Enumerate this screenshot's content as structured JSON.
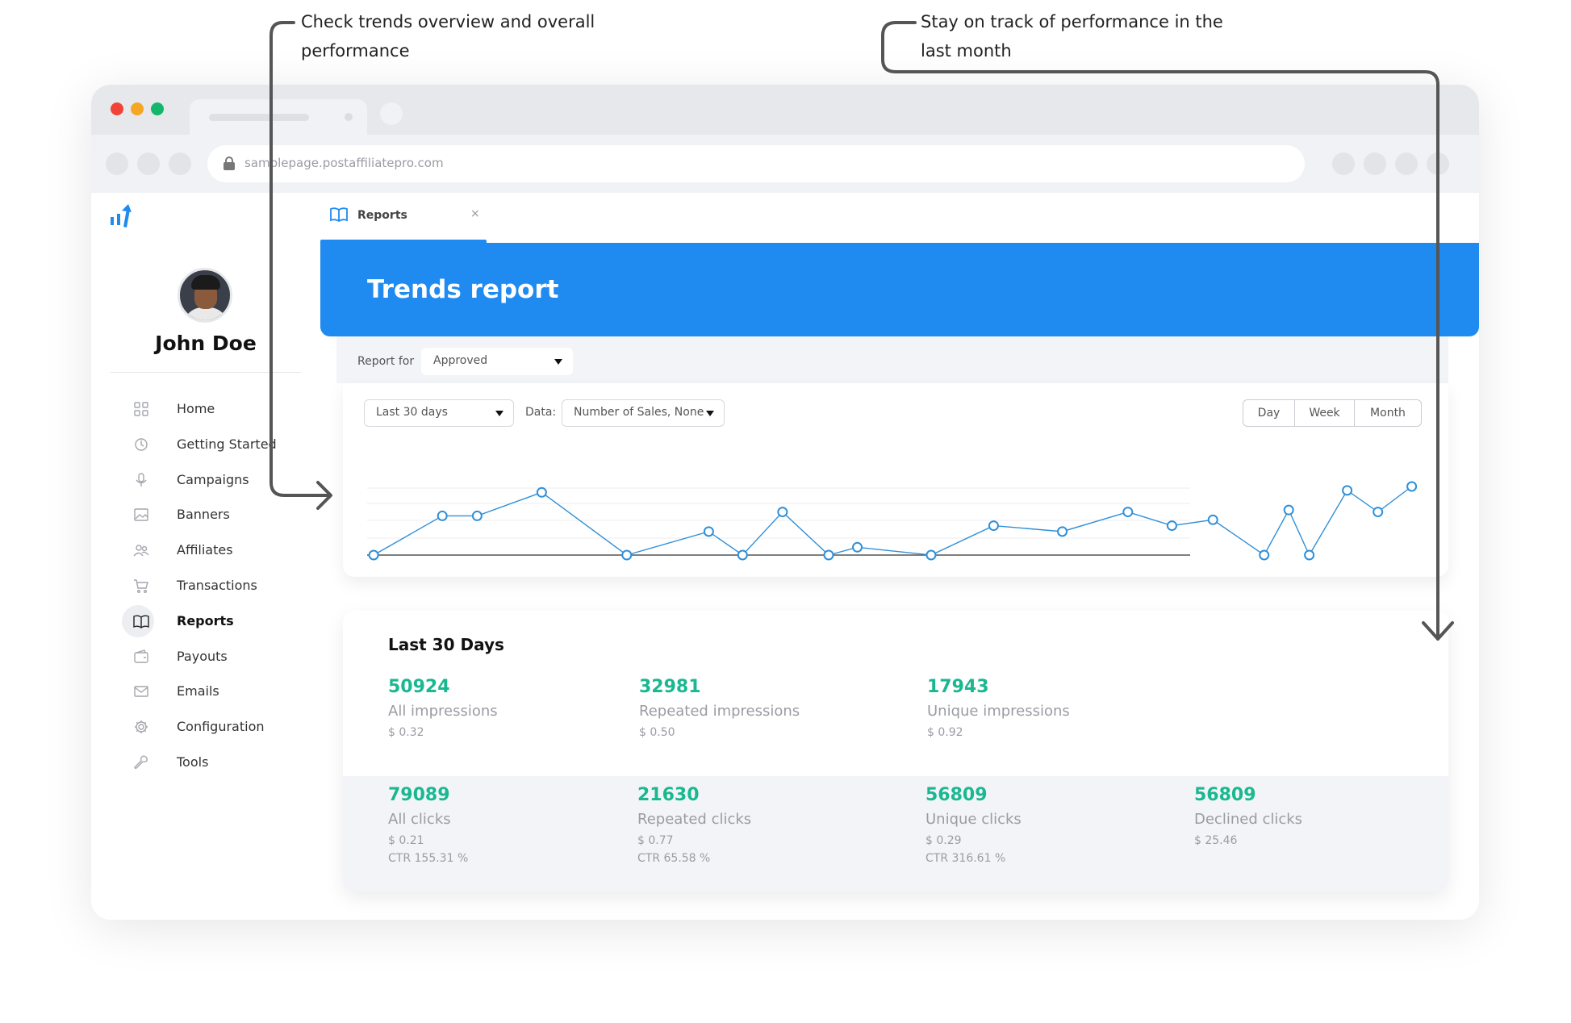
{
  "annotations": {
    "left": "Check trends overview and overall performance",
    "right": "Stay on track of performance in the last month"
  },
  "browser": {
    "url": "samplepage.postaffiliatepro.com"
  },
  "app": {
    "tab_label": "Reports",
    "tab_close": "×",
    "user_name": "John Doe",
    "nav": [
      {
        "label": "Home",
        "icon": "grid-icon"
      },
      {
        "label": "Getting Started",
        "icon": "clock-icon"
      },
      {
        "label": "Campaigns",
        "icon": "microphone-icon"
      },
      {
        "label": "Banners",
        "icon": "image-icon"
      },
      {
        "label": "Affiliates",
        "icon": "users-icon"
      },
      {
        "label": "Transactions",
        "icon": "cart-icon"
      },
      {
        "label": "Reports",
        "icon": "book-icon"
      },
      {
        "label": "Payouts",
        "icon": "wallet-icon"
      },
      {
        "label": "Emails",
        "icon": "mail-icon"
      },
      {
        "label": "Configuration",
        "icon": "gear-icon"
      },
      {
        "label": "Tools",
        "icon": "wrench-icon"
      }
    ],
    "active_nav": "Reports"
  },
  "report": {
    "title": "Trends report",
    "report_for_label": "Report for",
    "report_for_value": "Approved",
    "range_value": "Last 30 days",
    "data_label": "Data:",
    "metric_value": "Number of Sales, None",
    "period_buttons": [
      "Day",
      "Week",
      "Month"
    ]
  },
  "chart_data": {
    "type": "line",
    "x": [
      1,
      2,
      3,
      4,
      5,
      6,
      7,
      8,
      9,
      10,
      11,
      12,
      13,
      14,
      15,
      16,
      17,
      18,
      19,
      20,
      21,
      22,
      23,
      24,
      25,
      26
    ],
    "values": [
      0,
      2,
      2,
      3.2,
      0,
      1.2,
      0,
      2.2,
      0,
      0.4,
      0,
      1.5,
      1.2,
      2.2,
      1.5,
      1.8,
      0,
      2.3,
      0,
      3.3,
      2.2,
      3.5
    ],
    "line_color": "#2f8fd8",
    "grid": true
  },
  "stats": {
    "heading": "Last 30 Days",
    "impressions": [
      {
        "value": "50924",
        "label": "All impressions",
        "cost": "$ 0.32"
      },
      {
        "value": "32981",
        "label": "Repeated impressions",
        "cost": "$ 0.50"
      },
      {
        "value": "17943",
        "label": "Unique impressions",
        "cost": "$ 0.92"
      }
    ],
    "clicks": [
      {
        "value": "79089",
        "label": "All clicks",
        "cost": "$ 0.21",
        "ctr": "CTR 155.31 %"
      },
      {
        "value": "21630",
        "label": "Repeated clicks",
        "cost": "$ 0.77",
        "ctr": "CTR 65.58 %"
      },
      {
        "value": "56809",
        "label": "Unique clicks",
        "cost": "$ 0.29",
        "ctr": "CTR 316.61 %"
      },
      {
        "value": "56809",
        "label": "Declined clicks",
        "cost": "$ 25.46",
        "ctr": ""
      }
    ]
  },
  "colors": {
    "accent": "#1f8bf0",
    "stat_green": "#1ab891"
  }
}
